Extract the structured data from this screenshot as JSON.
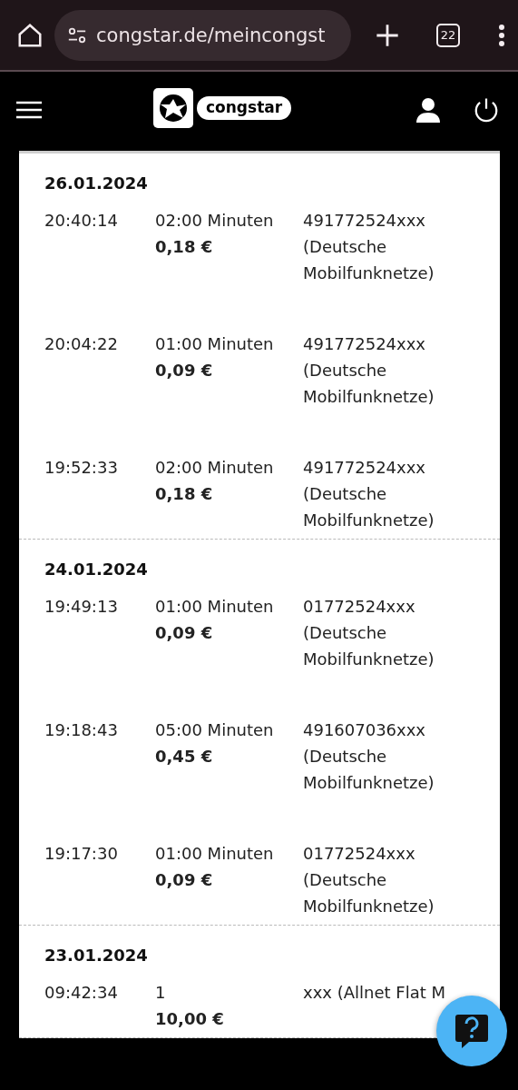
{
  "browser": {
    "url": "congstar.de/meincongst",
    "tab_count": "22"
  },
  "header": {
    "logo_text": "congstar"
  },
  "groups": [
    {
      "date": "26.01.2024",
      "rows": [
        {
          "time": "20:40:14",
          "duration": "02:00 Minuten",
          "price": "0,18 €",
          "number": "491772524xxx",
          "network": "(Deutsche Mobilfunknetze)"
        },
        {
          "time": "20:04:22",
          "duration": "01:00 Minuten",
          "price": "0,09 €",
          "number": "491772524xxx",
          "network": "(Deutsche Mobilfunknetze)"
        },
        {
          "time": "19:52:33",
          "duration": "02:00 Minuten",
          "price": "0,18 €",
          "number": "491772524xxx",
          "network": "(Deutsche Mobilfunknetze)"
        }
      ]
    },
    {
      "date": "24.01.2024",
      "rows": [
        {
          "time": "19:49:13",
          "duration": "01:00 Minuten",
          "price": "0,09 €",
          "number": "01772524xxx",
          "network": "(Deutsche Mobilfunknetze)"
        },
        {
          "time": "19:18:43",
          "duration": "05:00 Minuten",
          "price": "0,45 €",
          "number": "491607036xxx",
          "network": "(Deutsche Mobilfunknetze)"
        },
        {
          "time": "19:17:30",
          "duration": "01:00 Minuten",
          "price": "0,09 €",
          "number": "01772524xxx",
          "network": "(Deutsche Mobilfunknetze)"
        }
      ]
    },
    {
      "date": "23.01.2024",
      "rows": [
        {
          "time": "09:42:34",
          "duration": "1",
          "price": "10,00 €",
          "number": "xxx (Allnet Flat M"
        }
      ]
    }
  ]
}
